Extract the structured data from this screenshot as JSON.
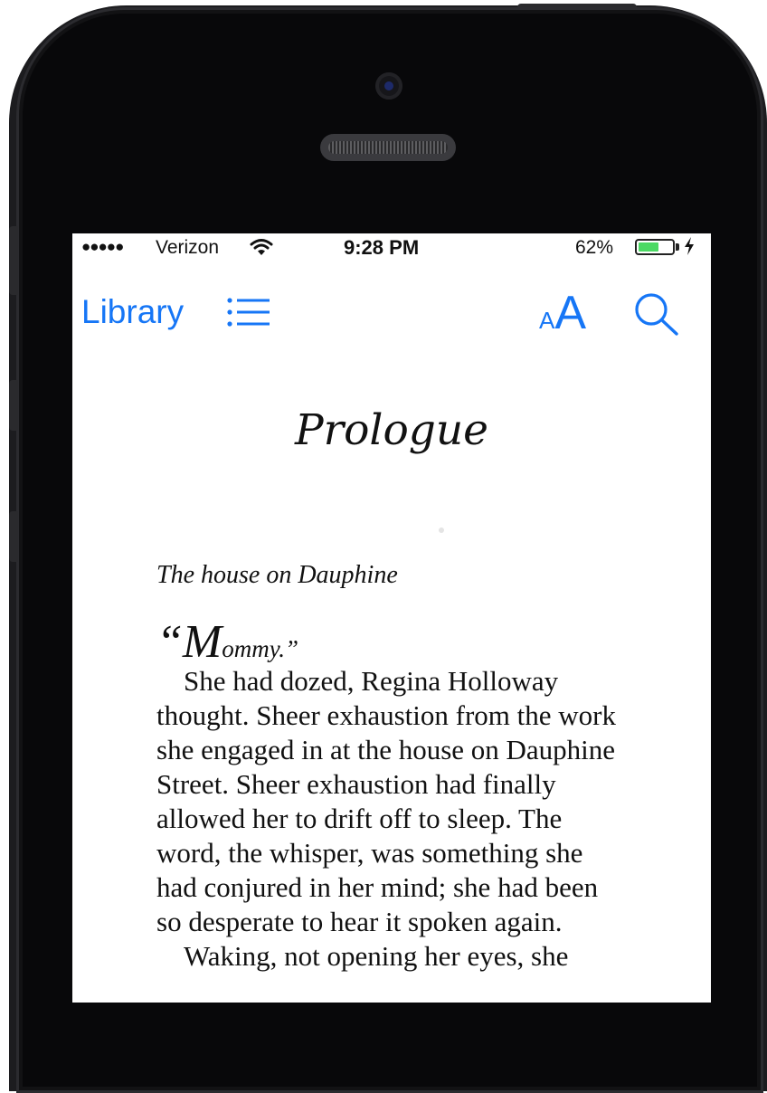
{
  "status_bar": {
    "signal": "●●●●●",
    "carrier": "Verizon",
    "time": "9:28 PM",
    "battery_percent": "62%",
    "battery_level": 0.62,
    "battery_color": "#4cd964"
  },
  "toolbar": {
    "library_label": "Library",
    "toc_icon": "list-icon",
    "font_small": "A",
    "font_large": "A",
    "search_icon": "search-icon",
    "accent_color": "#1676f6"
  },
  "book": {
    "chapter_title": "Prologue",
    "epigraph": "The house on Dauphine",
    "dropcap_open": "“M",
    "dropcap_rest": "ommy.”",
    "paragraphs": [
      "She had dozed, Regina Holloway thought. Sheer exhaustion from the work she engaged in at the house on Dauphine Street. Sheer exhaustion had finally allowed her to drift off to sleep. The word, the whisper, was something she had conjured in her mind; she had been so desperate to hear it spoken again.",
      "Waking, not opening her eyes, she"
    ]
  }
}
